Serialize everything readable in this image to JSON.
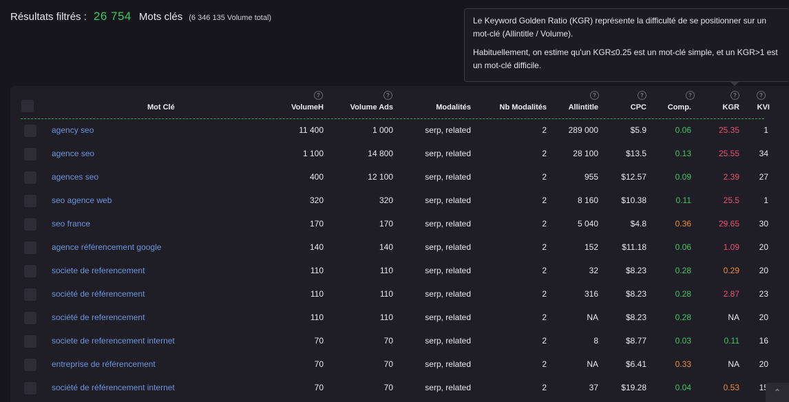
{
  "summary": {
    "label": "Résultats filtrés :",
    "count": "26 754",
    "unit": "Mots clés",
    "total": "(6 346 135 Volume total)"
  },
  "tooltip": {
    "p1": "Le Keyword Golden Ratio (KGR) représente la difficulté de se positionner sur un mot-clé (Allintitle / Volume).",
    "p2": "Habituellement, on estime qu'un KGR≤0.25 est un mot-clé simple, et un KGR>1 est un mot-clé difficile."
  },
  "columns": {
    "keyword": "Mot Clé",
    "volume": "VolumeH",
    "volume_ads": "Volume Ads",
    "modalities": "Modalités",
    "nb_modalities": "Nb Modalités",
    "allintitle": "Allintitle",
    "cpc": "CPC",
    "comp": "Comp.",
    "kgr": "KGR",
    "kvi": "KVI",
    "help_symbol": "?"
  },
  "colors": {
    "green": "#3dc75e",
    "orange": "#f08c32",
    "red": "#ec4f72",
    "link": "#6f95de"
  },
  "rows": [
    {
      "keyword": "agency seo",
      "volume": "11 400",
      "volume_ads": "1 000",
      "modalities": "serp, related",
      "nb": "2",
      "allintitle": "289 000",
      "cpc": "$5.9",
      "comp": "0.06",
      "comp_level": "green",
      "kgr": "25.35",
      "kgr_level": "red",
      "kvi": "1"
    },
    {
      "keyword": "agence seo",
      "volume": "1 100",
      "volume_ads": "14 800",
      "modalities": "serp, related",
      "nb": "2",
      "allintitle": "28 100",
      "cpc": "$13.5",
      "comp": "0.13",
      "comp_level": "green",
      "kgr": "25.55",
      "kgr_level": "red",
      "kvi": "34"
    },
    {
      "keyword": "agences seo",
      "volume": "400",
      "volume_ads": "12 100",
      "modalities": "serp, related",
      "nb": "2",
      "allintitle": "955",
      "cpc": "$12.57",
      "comp": "0.09",
      "comp_level": "green",
      "kgr": "2.39",
      "kgr_level": "red",
      "kvi": "27"
    },
    {
      "keyword": "seo agence web",
      "volume": "320",
      "volume_ads": "320",
      "modalities": "serp, related",
      "nb": "2",
      "allintitle": "8 160",
      "cpc": "$10.38",
      "comp": "0.11",
      "comp_level": "green",
      "kgr": "25.5",
      "kgr_level": "red",
      "kvi": "1"
    },
    {
      "keyword": "seo france",
      "volume": "170",
      "volume_ads": "170",
      "modalities": "serp, related",
      "nb": "2",
      "allintitle": "5 040",
      "cpc": "$4.8",
      "comp": "0.36",
      "comp_level": "orange",
      "kgr": "29.65",
      "kgr_level": "red",
      "kvi": "30"
    },
    {
      "keyword": "agence référencement google",
      "volume": "140",
      "volume_ads": "140",
      "modalities": "serp, related",
      "nb": "2",
      "allintitle": "152",
      "cpc": "$11.18",
      "comp": "0.06",
      "comp_level": "green",
      "kgr": "1.09",
      "kgr_level": "red",
      "kvi": "20"
    },
    {
      "keyword": "societe de referencement",
      "volume": "110",
      "volume_ads": "110",
      "modalities": "serp, related",
      "nb": "2",
      "allintitle": "32",
      "cpc": "$8.23",
      "comp": "0.28",
      "comp_level": "green",
      "kgr": "0.29",
      "kgr_level": "orange",
      "kvi": "20"
    },
    {
      "keyword": "société de référencement",
      "volume": "110",
      "volume_ads": "110",
      "modalities": "serp, related",
      "nb": "2",
      "allintitle": "316",
      "cpc": "$8.23",
      "comp": "0.28",
      "comp_level": "green",
      "kgr": "2.87",
      "kgr_level": "red",
      "kvi": "23"
    },
    {
      "keyword": "société de referencement",
      "volume": "110",
      "volume_ads": "110",
      "modalities": "serp, related",
      "nb": "2",
      "allintitle": "NA",
      "cpc": "$8.23",
      "comp": "0.28",
      "comp_level": "green",
      "kgr": "NA",
      "kgr_level": "neutral",
      "kvi": "20"
    },
    {
      "keyword": "societe de referencement internet",
      "volume": "70",
      "volume_ads": "70",
      "modalities": "serp, related",
      "nb": "2",
      "allintitle": "8",
      "cpc": "$8.77",
      "comp": "0.03",
      "comp_level": "green",
      "kgr": "0.11",
      "kgr_level": "green",
      "kvi": "16"
    },
    {
      "keyword": "entreprise de référencement",
      "volume": "70",
      "volume_ads": "70",
      "modalities": "serp, related",
      "nb": "2",
      "allintitle": "NA",
      "cpc": "$6.41",
      "comp": "0.33",
      "comp_level": "orange",
      "kgr": "NA",
      "kgr_level": "neutral",
      "kvi": "20"
    },
    {
      "keyword": "société de référencement internet",
      "volume": "70",
      "volume_ads": "70",
      "modalities": "serp, related",
      "nb": "2",
      "allintitle": "37",
      "cpc": "$19.28",
      "comp": "0.04",
      "comp_level": "green",
      "kgr": "0.53",
      "kgr_level": "orange",
      "kvi": "15"
    }
  ]
}
